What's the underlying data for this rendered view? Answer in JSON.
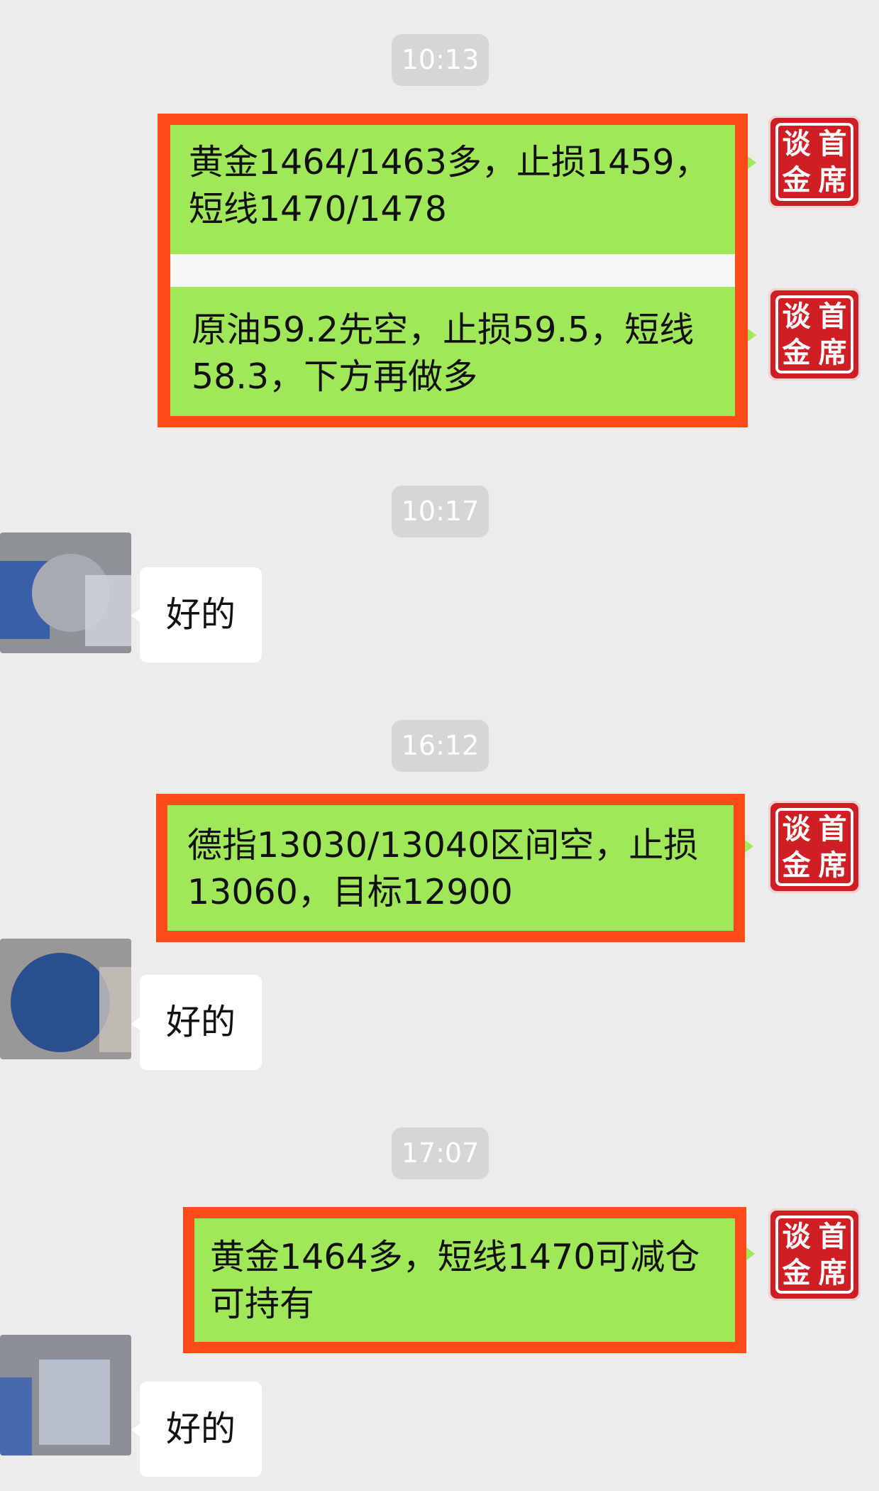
{
  "timestamps": [
    "10:13",
    "10:17",
    "16:12",
    "17:07"
  ],
  "outgoing": [
    {
      "line1": "黄金1464/1463多，止损1459，",
      "line2": "短线1470/1478"
    },
    {
      "line1": "原油59.2先空，止损59.5，短线",
      "line2": "58.3，下方再做多"
    },
    {
      "line1": "德指13030/13040区间空，止损",
      "line2": "13060，目标12900"
    },
    {
      "line1": "黄金1464多，短线1470可减仓",
      "line2": "可持有"
    }
  ],
  "incoming": [
    {
      "text": "好的"
    },
    {
      "text": "好的"
    },
    {
      "text": "好的"
    }
  ],
  "seal": {
    "chars": [
      "谈",
      "首",
      "金",
      "席"
    ]
  },
  "colors": {
    "background": "#ececec",
    "outgoing_bubble": "#a0e75a",
    "incoming_bubble": "#ffffff",
    "highlight_border": "#ff4a1a",
    "seal_red": "#cf1f24",
    "timestamp_bg": "#d6d6d6"
  }
}
